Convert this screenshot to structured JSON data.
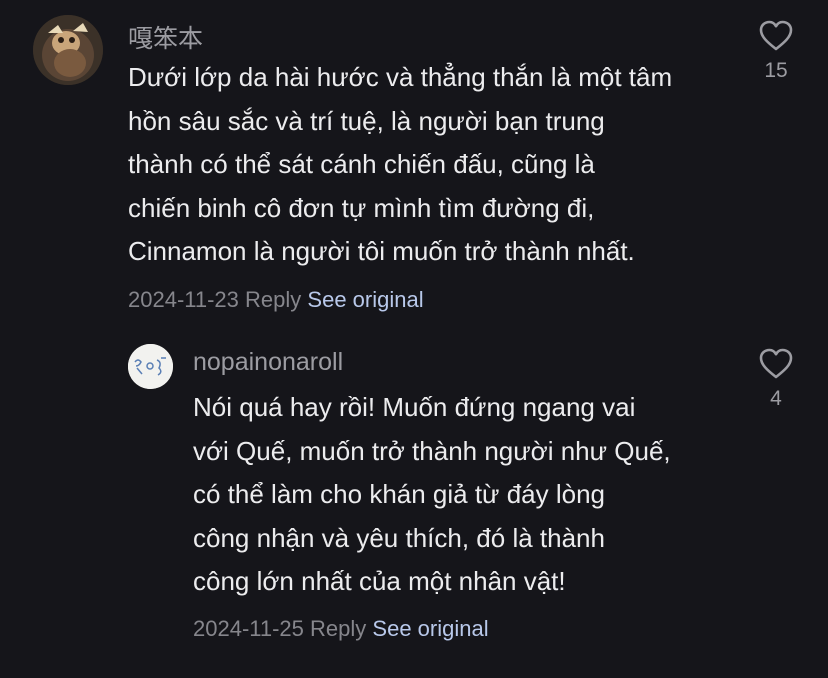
{
  "comments": [
    {
      "username": "嘎笨本",
      "lines": [
        "Dưới lớp da hài hước và thẳng thắn là một tâm",
        "hồn sâu sắc và trí tuệ, là người bạn trung",
        "thành có thể sát cánh chiến đấu, cũng là",
        "chiến binh cô đơn tự mình tìm đường đi,",
        "Cinnamon là người tôi muốn trở thành nhất."
      ],
      "date": "2024-11-23",
      "reply_label": "Reply",
      "see_original_label": "See original",
      "likes": "15"
    },
    {
      "username": "nopainonaroll",
      "lines": [
        "Nói quá hay rồi! Muốn đứng ngang vai",
        "với Quế, muốn trở thành người như Quế,",
        "có thể làm cho khán giả từ đáy lòng",
        "công nhận và yêu thích, đó là thành",
        "công lớn nhất của một nhân vật!"
      ],
      "date": "2024-11-25",
      "reply_label": "Reply",
      "see_original_label": "See original",
      "likes": "4"
    }
  ],
  "icons": {
    "like": "heart-outline-icon",
    "avatar1": "avatar-image",
    "avatar2": "avatar-image"
  }
}
